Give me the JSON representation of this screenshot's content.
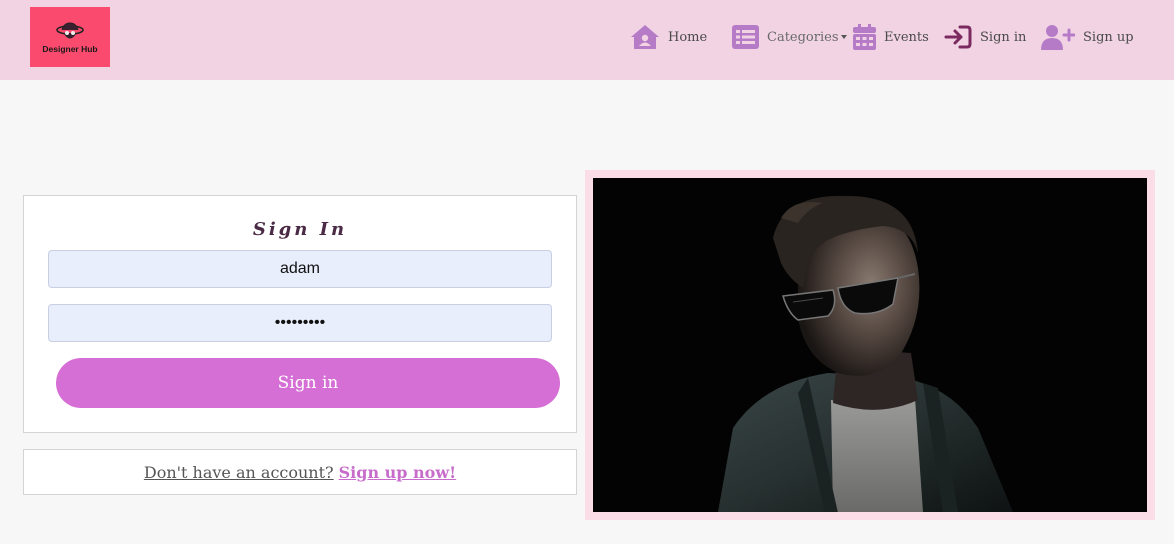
{
  "brand": {
    "logo_text": "Designer Hub",
    "logo_color": "#fa4a6d"
  },
  "nav": {
    "background": "#f1d3e4",
    "accent": "#b67bc7",
    "items": [
      {
        "label": "Home",
        "icon": "home-icon"
      },
      {
        "label": "Categories",
        "icon": "list-icon",
        "dropdown": true
      },
      {
        "label": "Events",
        "icon": "calendar-icon"
      },
      {
        "label": "Sign in",
        "icon": "sign-in-icon"
      },
      {
        "label": "Sign up",
        "icon": "user-plus-icon"
      }
    ]
  },
  "signin": {
    "title": "Sign In",
    "username_value": "adam",
    "password_value": "passwords",
    "button_label": "Sign in",
    "button_color": "#d56fd6"
  },
  "signup": {
    "prompt": "Don't have an account?",
    "link_label": "Sign up now!"
  },
  "hero": {
    "image": "man-in-sunglasses-denim-jacket-photo",
    "frame_color": "#fbdde7"
  }
}
